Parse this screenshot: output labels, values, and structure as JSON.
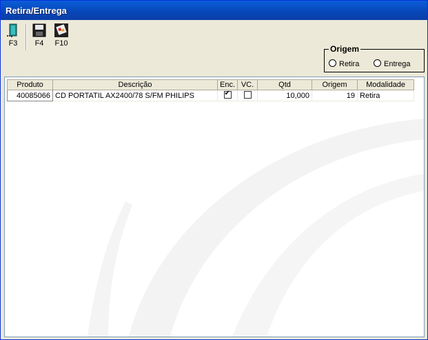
{
  "window": {
    "title": "Retira/Entrega"
  },
  "toolbar": {
    "buttons": [
      {
        "label": "F3",
        "icon": "door-exit-icon"
      },
      {
        "label": "F4",
        "icon": "floppy-save-icon"
      },
      {
        "label": "F10",
        "icon": "print-icon"
      }
    ]
  },
  "origem": {
    "legend": "Origem",
    "options": [
      "Retira",
      "Entrega"
    ]
  },
  "grid": {
    "headers": [
      "Produto",
      "Descrição",
      "Enc.",
      "VC.",
      "Qtd",
      "Origem",
      "Modalidade"
    ],
    "rows": [
      {
        "produto": "40085066",
        "descricao": "CD PORTATIL AX2400/78 S/FM PHILIPS",
        "enc": true,
        "vc": false,
        "qtd": "10,000",
        "origem": "19",
        "modalidade": "Retira"
      }
    ]
  }
}
